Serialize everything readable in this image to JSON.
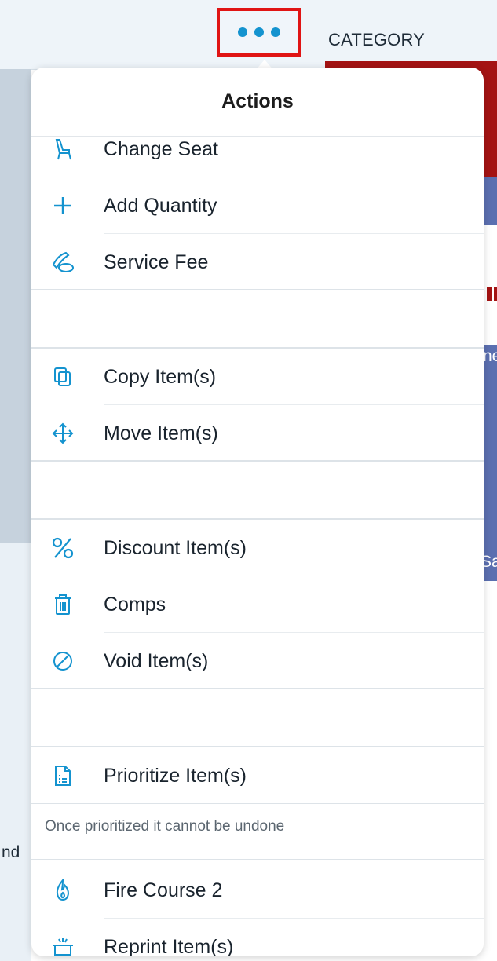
{
  "header": {
    "more_icon": "more-horizontal-icon",
    "category_label": "CATEGORY"
  },
  "background": {
    "fragments": [
      "nd",
      "ne",
      "Sa"
    ]
  },
  "actions_menu": {
    "title": "Actions",
    "groups": [
      {
        "items": [
          {
            "label": "Change Seat",
            "icon": "chair-icon"
          },
          {
            "label": "Add Quantity",
            "icon": "plus-icon"
          },
          {
            "label": "Service Fee",
            "icon": "service-fee-icon"
          }
        ]
      },
      {
        "items": [
          {
            "label": "Copy Item(s)",
            "icon": "copy-icon"
          },
          {
            "label": "Move Item(s)",
            "icon": "move-arrows-icon"
          }
        ]
      },
      {
        "items": [
          {
            "label": "Discount Item(s)",
            "icon": "percent-icon"
          },
          {
            "label": "Comps",
            "icon": "trash-icon"
          },
          {
            "label": "Void Item(s)",
            "icon": "void-circle-icon"
          }
        ]
      },
      {
        "items": [
          {
            "label": "Prioritize Item(s)",
            "icon": "prioritize-document-icon"
          }
        ],
        "note": "Once prioritized it cannot be undone"
      },
      {
        "items": [
          {
            "label": "Fire Course 2",
            "icon": "flame-icon"
          },
          {
            "label": "Reprint Item(s)",
            "icon": "printer-icon"
          }
        ]
      }
    ]
  },
  "colors": {
    "accent": "#1493cf",
    "highlight_box": "#e01414",
    "category_tab": "#a41313"
  }
}
